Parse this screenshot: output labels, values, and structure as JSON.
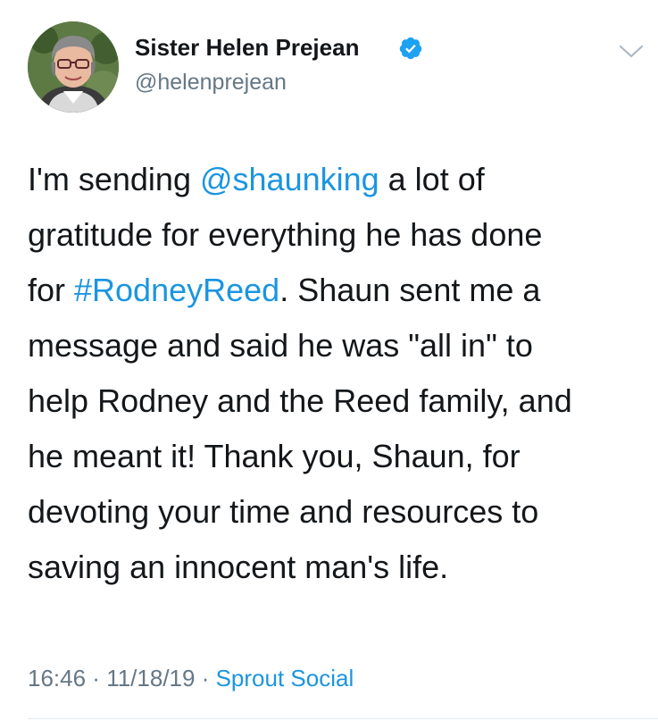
{
  "author": {
    "display_name": "Sister Helen Prejean",
    "handle": "@helenprejean",
    "verified": true,
    "avatar_icon": "profile-photo"
  },
  "tweet": {
    "lines": [
      [
        {
          "text": "I'm sending "
        },
        {
          "text": "@shaunking",
          "link": true
        },
        {
          "text": " a lot of"
        }
      ],
      [
        {
          "text": "gratitude for everything he has done"
        }
      ],
      [
        {
          "text": "for "
        },
        {
          "text": "#RodneyReed",
          "link": true
        },
        {
          "text": ". Shaun sent me a"
        }
      ],
      [
        {
          "text": "message and said he was \"all in\" to"
        }
      ],
      [
        {
          "text": "help Rodney and the Reed family, and"
        }
      ],
      [
        {
          "text": "he meant it! Thank you, Shaun, for"
        }
      ],
      [
        {
          "text": "devoting your time and resources to"
        }
      ],
      [
        {
          "text": "saving an innocent man's life."
        }
      ]
    ],
    "time": "16:46",
    "separator": " · ",
    "date": "11/18/19",
    "source": "Sprout Social"
  },
  "colors": {
    "text": "#14171a",
    "secondary": "#657786",
    "link": "#1b95e0",
    "divider": "#e1e8ed"
  },
  "icons": {
    "verified": "verified-badge-icon",
    "menu": "chevron-down-icon"
  }
}
